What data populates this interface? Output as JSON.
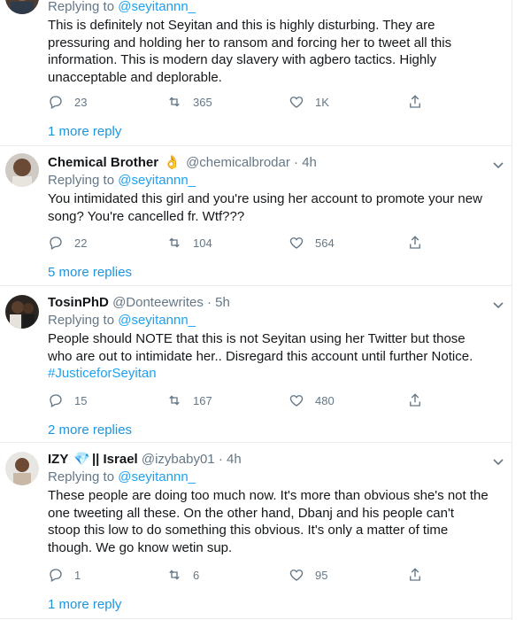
{
  "tweets": [
    {
      "replying_prefix": "Replying to",
      "replying_handle": "@seyitannn_",
      "text": "This is definitely not Seyitan and this is highly disturbing. They are pressuring and holding her to ransom and forcing her to tweet all this information. This is modern day slavery with agbero tactics. Highly unacceptable and deplorable.",
      "replies": "23",
      "retweets": "365",
      "likes": "1K",
      "more_replies": "1 more reply"
    },
    {
      "name": "Chemical Brother",
      "emoji": "👌",
      "handle": "@chemicalbrodar",
      "time": "· 4h",
      "replying_prefix": "Replying to",
      "replying_handle": "@seyitannn_",
      "text": "You intimidated this girl and you're using her account to promote your new song? You're cancelled fr. Wtf???",
      "replies": "22",
      "retweets": "104",
      "likes": "564",
      "more_replies": "5 more replies"
    },
    {
      "name": "TosinPhD",
      "handle": "@Donteewrites",
      "time": "· 5h",
      "replying_prefix": "Replying to",
      "replying_handle": "@seyitannn_",
      "text": "People should NOTE that  this is not Seyitan using her Twitter but those who are out to intimidate her.. Disregard this account until further Notice.",
      "hashtag": "#JusticeforSeyitan",
      "replies": "15",
      "retweets": "167",
      "likes": "480",
      "more_replies": "2 more replies"
    },
    {
      "name": "IZY",
      "emoji": "💎",
      "name_suffix": "|| Israel",
      "handle": "@izybaby01",
      "time": "· 4h",
      "replying_prefix": "Replying to",
      "replying_handle": "@seyitannn_",
      "text": "These people are doing too much now. It's more than obvious she's not the one tweeting all these. On the other hand, Dbanj and his people can't stoop this low to do something this obvious. It's only a matter of time though. We go know wetin sup.",
      "replies": "1",
      "retweets": "6",
      "likes": "95",
      "more_replies": "1 more reply"
    }
  ],
  "colors": {
    "link": "#1da1f2",
    "secondary_text": "#657786",
    "primary_text": "#14171a",
    "separator": "#e6ecf0"
  }
}
